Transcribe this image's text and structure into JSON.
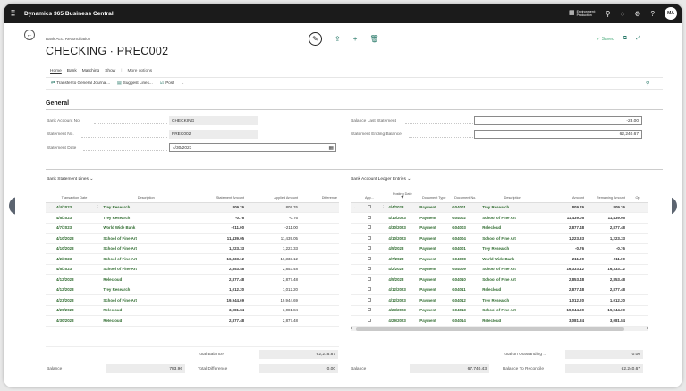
{
  "app": {
    "title": "Dynamics 365 Business Central",
    "environment_line1": "Environment:",
    "environment_line2": "Production",
    "avatar_initials": "MA"
  },
  "page": {
    "breadcrumb": "Bank Acc. Reconciliation",
    "title": "CHECKING ∙ PREC002",
    "saved_label": "Saved"
  },
  "tabs": [
    {
      "label": "Home"
    },
    {
      "label": "Bank"
    },
    {
      "label": "Matching"
    },
    {
      "label": "Show"
    },
    {
      "label": "More options"
    }
  ],
  "actions": [
    {
      "label": "Transfer to General Journal..."
    },
    {
      "label": "Suggest Lines..."
    },
    {
      "label": "Post"
    }
  ],
  "general": {
    "heading": "General",
    "bank_account_no": {
      "label": "Bank Account No.",
      "value": "CHECKING"
    },
    "statement_no": {
      "label": "Statement No.",
      "value": "PREC002"
    },
    "statement_date": {
      "label": "Statement Date",
      "value": "4/30/2023"
    },
    "balance_last_statement": {
      "label": "Balance Last Statement",
      "value": "-23.00"
    },
    "statement_ending_balance": {
      "label": "Statement Ending Balance",
      "value": "62,240.67"
    }
  },
  "bank_statement_lines": {
    "title": "Bank Statement Lines",
    "columns": [
      "Transaction Date",
      "Description",
      "Statement Amount",
      "Applied Amount",
      "Difference"
    ],
    "rows": [
      {
        "date": "4/4/2023",
        "desc": "Trey Research",
        "amount": "809.76",
        "applied": "809.76",
        "diff": ""
      },
      {
        "date": "4/5/2023",
        "desc": "Trey Research",
        "amount": "-0.76",
        "applied": "-0.76",
        "diff": ""
      },
      {
        "date": "4/7/2023",
        "desc": "World Wide Bank",
        "amount": "-211.00",
        "applied": "-211.00",
        "diff": ""
      },
      {
        "date": "4/10/2023",
        "desc": "School of Fine Art",
        "amount": "11,439.05",
        "applied": "11,439.05",
        "diff": ""
      },
      {
        "date": "4/10/2023",
        "desc": "School of Fine Art",
        "amount": "1,223.33",
        "applied": "1,223.33",
        "diff": ""
      },
      {
        "date": "4/2/2023",
        "desc": "School of Fine Art",
        "amount": "16,333.12",
        "applied": "16,333.12",
        "diff": ""
      },
      {
        "date": "4/5/2023",
        "desc": "School of Fine Art",
        "amount": "2,853.48",
        "applied": "2,853.48",
        "diff": ""
      },
      {
        "date": "4/12/2023",
        "desc": "Relecloud",
        "amount": "2,877.48",
        "applied": "2,877.48",
        "diff": ""
      },
      {
        "date": "4/12/2023",
        "desc": "Trey Research",
        "amount": "1,012.20",
        "applied": "1,012.20",
        "diff": ""
      },
      {
        "date": "4/23/2023",
        "desc": "School of Fine Art",
        "amount": "19,944.69",
        "applied": "19,944.69",
        "diff": ""
      },
      {
        "date": "4/29/2023",
        "desc": "Relecloud",
        "amount": "3,081.84",
        "applied": "3,081.84",
        "diff": ""
      },
      {
        "date": "4/30/2023",
        "desc": "Relecloud",
        "amount": "2,877.48",
        "applied": "2,877.48",
        "diff": ""
      }
    ],
    "total_balance_label": "Total Balance",
    "total_balance": "62,216.87",
    "balance_label": "Balance",
    "balance": "783.96",
    "total_difference_label": "Total Difference",
    "total_difference": "0.00"
  },
  "ledger_entries": {
    "title": "Bank Account Ledger Entries",
    "columns": [
      "App...",
      "Posting Date",
      "Document Type",
      "Document No.",
      "Description",
      "Amount",
      "Remaining Amount",
      "Op"
    ],
    "rows": [
      {
        "date": "4/4/2023",
        "type": "Payment",
        "doc": "G04001",
        "desc": "Trey Research",
        "amount": "809.76",
        "remaining": "809.76"
      },
      {
        "date": "4/10/2023",
        "type": "Payment",
        "doc": "G04002",
        "desc": "School of Fine Art",
        "amount": "11,439.05",
        "remaining": "11,439.05"
      },
      {
        "date": "4/30/2023",
        "type": "Payment",
        "doc": "G04003",
        "desc": "Relecloud",
        "amount": "2,877.48",
        "remaining": "2,877.48"
      },
      {
        "date": "4/10/2023",
        "type": "Payment",
        "doc": "G04004",
        "desc": "School of Fine Art",
        "amount": "1,223.33",
        "remaining": "1,223.33"
      },
      {
        "date": "4/5/2023",
        "type": "Payment",
        "doc": "G04001",
        "desc": "Trey Research",
        "amount": "-0.76",
        "remaining": "-0.76"
      },
      {
        "date": "4/7/2023",
        "type": "Payment",
        "doc": "G04008",
        "desc": "World Wide Bank",
        "amount": "-211.00",
        "remaining": "-211.00"
      },
      {
        "date": "4/2/2023",
        "type": "Payment",
        "doc": "G04009",
        "desc": "School of Fine Art",
        "amount": "16,333.12",
        "remaining": "16,333.12"
      },
      {
        "date": "4/5/2023",
        "type": "Payment",
        "doc": "G04010",
        "desc": "School of Fine Art",
        "amount": "2,853.48",
        "remaining": "2,853.48"
      },
      {
        "date": "4/12/2023",
        "type": "Payment",
        "doc": "G04011",
        "desc": "Relecloud",
        "amount": "2,877.48",
        "remaining": "2,877.48"
      },
      {
        "date": "4/12/2023",
        "type": "Payment",
        "doc": "G04012",
        "desc": "Trey Research",
        "amount": "1,012.20",
        "remaining": "1,012.20"
      },
      {
        "date": "4/23/2023",
        "type": "Payment",
        "doc": "G04013",
        "desc": "School of Fine Art",
        "amount": "19,944.69",
        "remaining": "19,944.69"
      },
      {
        "date": "4/29/2023",
        "type": "Payment",
        "doc": "G04014",
        "desc": "Relecloud",
        "amount": "3,081.84",
        "remaining": "3,081.84"
      }
    ],
    "total_outstanding_label": "Total on Outstanding ...",
    "total_outstanding": "0.00",
    "balance_label": "Balance",
    "balance": "67,740.43",
    "balance_to_reconcile_label": "Balance To Reconcile",
    "balance_to_reconcile": "62,240.67"
  }
}
